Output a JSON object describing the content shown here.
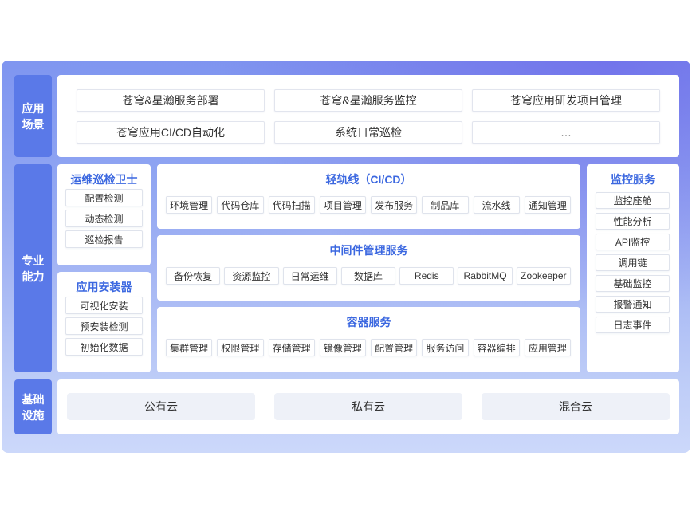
{
  "colors": {
    "accent_title": "#3c68e0",
    "layer_label_bg": "#5a79e8",
    "frame_top": "#7e91ee",
    "frame_bottom": "#ccd8fa",
    "cloud_bg": "#eef1f8"
  },
  "layers": {
    "application": {
      "label": [
        "应用",
        "场景"
      ],
      "items": [
        "苍穹&星瀚服务部署",
        "苍穹&星瀚服务监控",
        "苍穹应用研发项目管理",
        "苍穹应用CI/CD自动化",
        "系统日常巡检",
        "…"
      ]
    },
    "capability": {
      "label": [
        "专业",
        "能力"
      ],
      "inspection": {
        "title": "运维巡检卫士",
        "items": [
          "配置检测",
          "动态检测",
          "巡检报告"
        ]
      },
      "installer": {
        "title": "应用安装器",
        "items": [
          "可视化安装",
          "预安装检测",
          "初始化数据"
        ]
      },
      "cicd": {
        "title": "轻轨线（CI/CD）",
        "items": [
          "环境管理",
          "代码仓库",
          "代码扫描",
          "项目管理",
          "发布服务",
          "制品库",
          "流水线",
          "通知管理"
        ]
      },
      "middleware": {
        "title": "中间件管理服务",
        "items": [
          "备份恢复",
          "资源监控",
          "日常运维",
          "数据库",
          "Redis",
          "RabbitMQ",
          "Zookeeper"
        ]
      },
      "container": {
        "title": "容器服务",
        "items": [
          "集群管理",
          "权限管理",
          "存储管理",
          "镜像管理",
          "配置管理",
          "服务访问",
          "容器编排",
          "应用管理"
        ]
      },
      "monitoring": {
        "title": "监控服务",
        "items": [
          "监控座舱",
          "性能分析",
          "API监控",
          "调用链",
          "基础监控",
          "报警通知",
          "日志事件"
        ]
      }
    },
    "infrastructure": {
      "label": [
        "基础",
        "设施"
      ],
      "items": [
        "公有云",
        "私有云",
        "混合云"
      ]
    }
  }
}
